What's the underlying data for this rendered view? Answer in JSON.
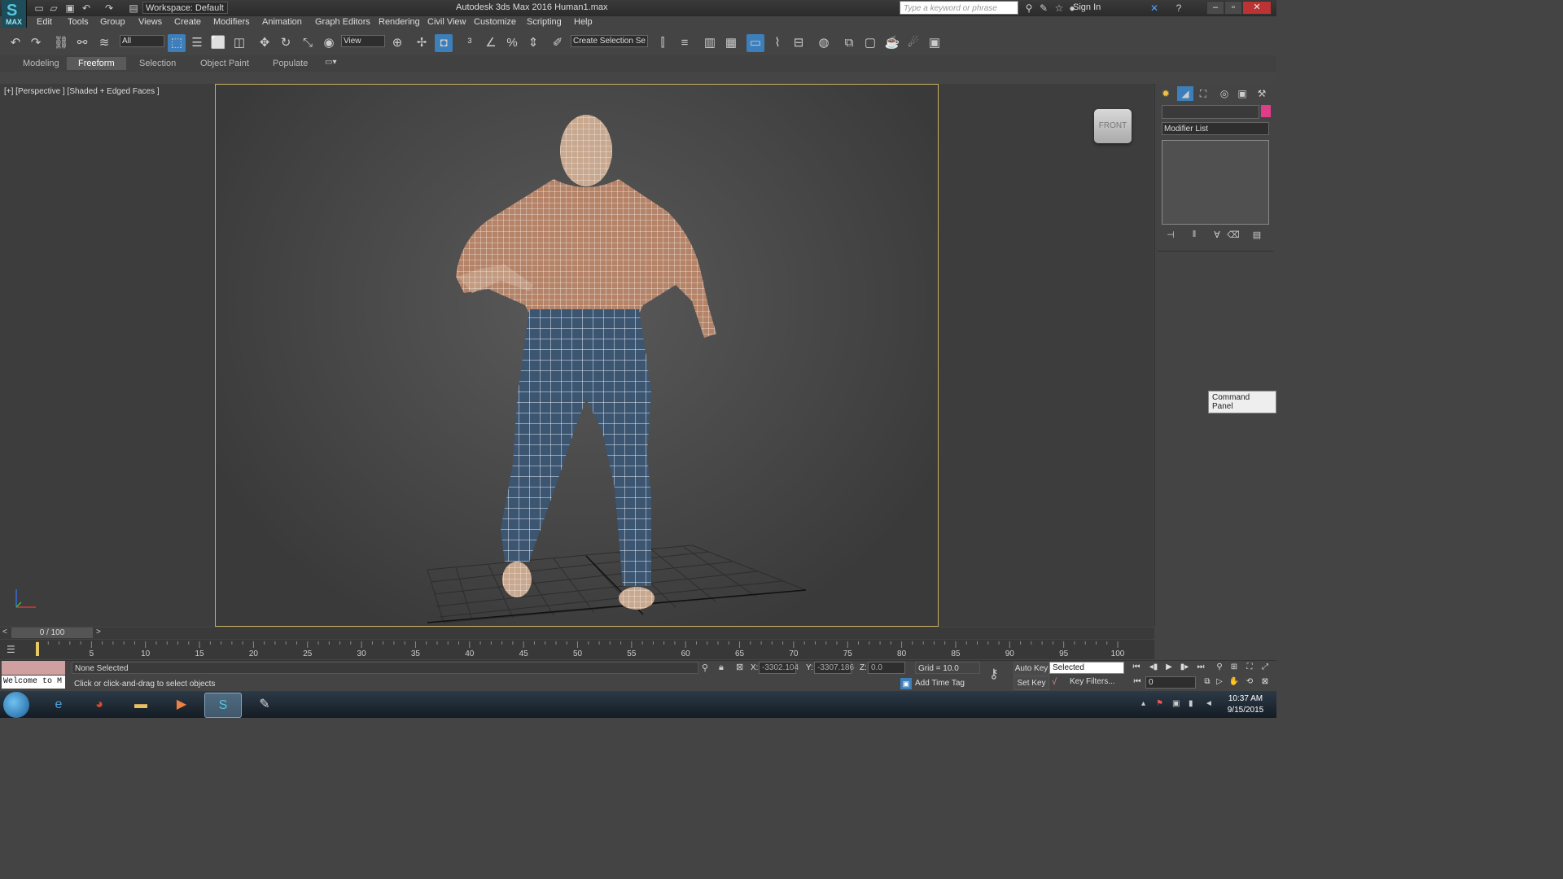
{
  "titlebar": {
    "app_logo": "MAX",
    "workspace": "Workspace: Default",
    "title": "Autodesk 3ds Max 2016      Human1.max",
    "search_placeholder": "Type a keyword or phrase",
    "sign_in": "Sign In"
  },
  "menu": [
    "Edit",
    "Tools",
    "Group",
    "Views",
    "Create",
    "Modifiers",
    "Animation",
    "Graph Editors",
    "Rendering",
    "Civil View",
    "Customize",
    "Scripting",
    "Help"
  ],
  "toolbar": {
    "filter": "All",
    "ref_coord": "View",
    "selection_set": "Create Selection Se"
  },
  "ribbon_tabs": [
    "Modeling",
    "Freeform",
    "Selection",
    "Object Paint",
    "Populate"
  ],
  "ribbon_active": "Freeform",
  "viewport": {
    "label": "[+] [Perspective ] [Shaded + Edged Faces ]",
    "viewcube": "FRONT"
  },
  "command_panel": {
    "modifier_list": "Modifier List",
    "tooltip": "Command Panel",
    "swatch_color": "#e03c8a"
  },
  "timeline": {
    "frame": "0 / 100",
    "ticks": [
      "5",
      "10",
      "15",
      "20",
      "25",
      "30",
      "35",
      "40",
      "45",
      "50",
      "55",
      "60",
      "65",
      "70",
      "75",
      "80",
      "85",
      "90",
      "95",
      "100"
    ]
  },
  "status": {
    "welcome": "Welcome to M",
    "selection": "None Selected",
    "prompt": "Click or click-and-drag to select objects",
    "x_label": "X:",
    "x": "-3302.104",
    "y_label": "Y:",
    "y": "-3307.186",
    "z_label": "Z:",
    "z": "0.0",
    "grid": "Grid = 10.0",
    "add_time_tag": "Add Time Tag",
    "auto_key": "Auto Key",
    "set_key": "Set Key",
    "selected": "Selected",
    "key_filters": "Key Filters...",
    "frame_value": "0"
  },
  "taskbar": {
    "time": "10:37 AM",
    "date": "9/15/2015"
  }
}
